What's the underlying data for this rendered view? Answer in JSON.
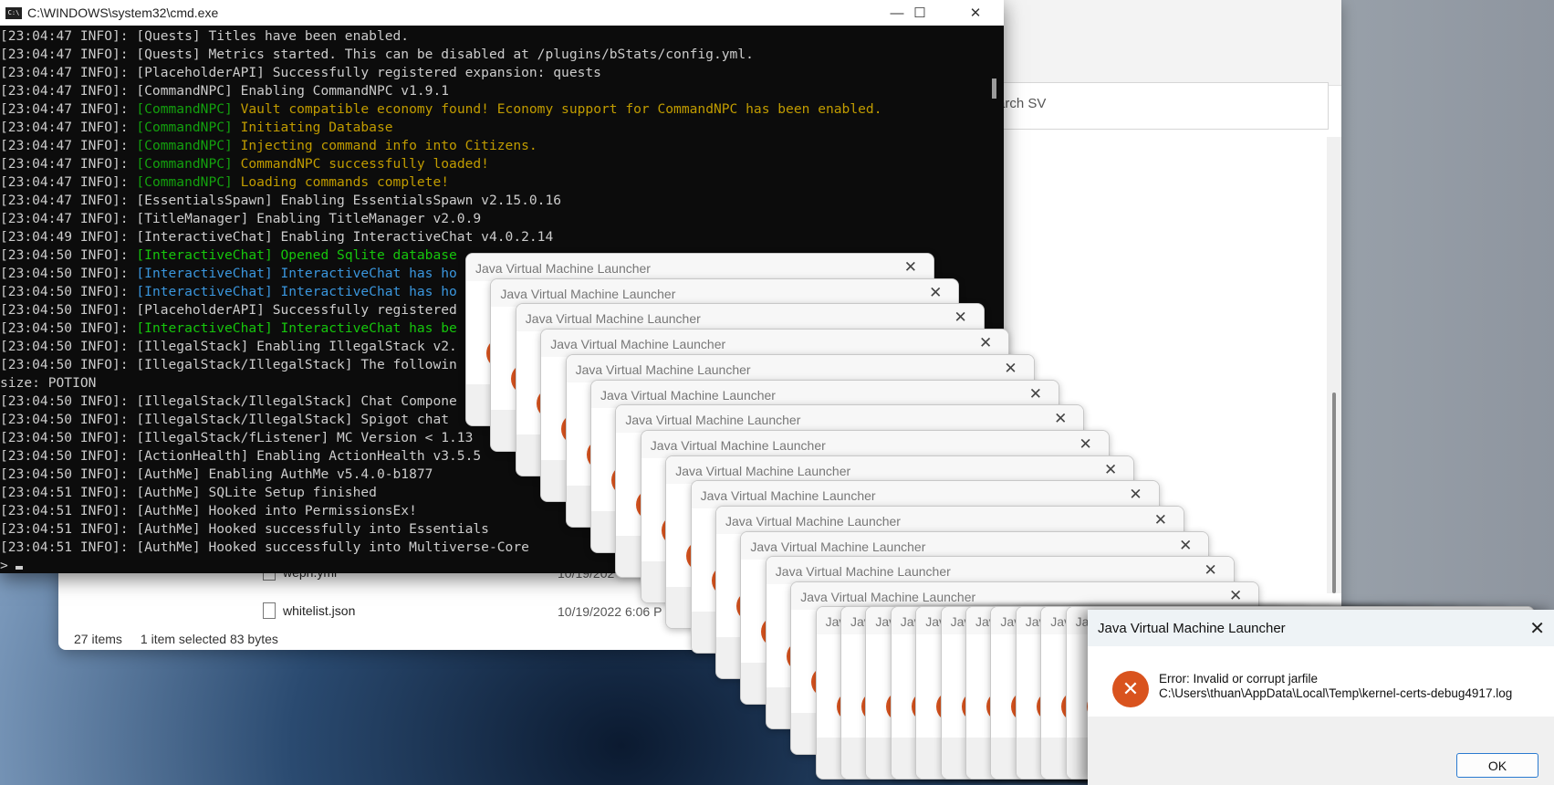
{
  "cmd": {
    "title": "C:\\WINDOWS\\system32\\cmd.exe",
    "icon_label": "C:\\",
    "minimize": "—",
    "maximize": "☐",
    "close": "✕",
    "prompt": ">",
    "lines": [
      [
        [
          "[23:04:47 INFO]: [Quests] Titles have been enabled.",
          "#cccccc"
        ]
      ],
      [
        [
          "[23:04:47 INFO]: [Quests] Metrics started. This can be disabled at /plugins/bStats/config.yml.",
          "#cccccc"
        ]
      ],
      [
        [
          "[23:04:47 INFO]: [PlaceholderAPI] Successfully registered expansion: quests",
          "#cccccc"
        ]
      ],
      [
        [
          "[23:04:47 INFO]: [CommandNPC] Enabling CommandNPC v1.9.1",
          "#cccccc"
        ]
      ],
      [
        [
          "[23:04:47 INFO]: ",
          "#cccccc"
        ],
        [
          "[CommandNPC]",
          "#13a10e"
        ],
        [
          " Vault compatible economy found! Economy support for CommandNPC has been enabled.",
          "#c19c00"
        ]
      ],
      [
        [
          "[23:04:47 INFO]: ",
          "#cccccc"
        ],
        [
          "[CommandNPC]",
          "#13a10e"
        ],
        [
          " Initiating Database",
          "#c19c00"
        ]
      ],
      [
        [
          "[23:04:47 INFO]: ",
          "#cccccc"
        ],
        [
          "[CommandNPC]",
          "#13a10e"
        ],
        [
          " Injecting command info into Citizens.",
          "#c19c00"
        ]
      ],
      [
        [
          "[23:04:47 INFO]: ",
          "#cccccc"
        ],
        [
          "[CommandNPC]",
          "#13a10e"
        ],
        [
          " CommandNPC successfully loaded!",
          "#c19c00"
        ]
      ],
      [
        [
          "[23:04:47 INFO]: ",
          "#cccccc"
        ],
        [
          "[CommandNPC]",
          "#13a10e"
        ],
        [
          " Loading commands complete!",
          "#c19c00"
        ]
      ],
      [
        [
          "[23:04:47 INFO]: [EssentialsSpawn] Enabling EssentialsSpawn v2.15.0.16",
          "#cccccc"
        ]
      ],
      [
        [
          "[23:04:47 INFO]: [TitleManager] Enabling TitleManager v2.0.9",
          "#cccccc"
        ]
      ],
      [
        [
          "[23:04:49 INFO]: [InteractiveChat] Enabling InteractiveChat v4.0.2.14",
          "#cccccc"
        ]
      ],
      [
        [
          "[23:04:50 INFO]: ",
          "#cccccc"
        ],
        [
          "[InteractiveChat] Opened Sqlite database",
          "#16c60c"
        ]
      ],
      [
        [
          "[23:04:50 INFO]: ",
          "#cccccc"
        ],
        [
          "[InteractiveChat] InteractiveChat has ho",
          "#3a96dd"
        ]
      ],
      [
        [
          "[23:04:50 INFO]: ",
          "#cccccc"
        ],
        [
          "[InteractiveChat] InteractiveChat has ho",
          "#3a96dd"
        ]
      ],
      [
        [
          "[23:04:50 INFO]: [PlaceholderAPI] Successfully registered",
          "#cccccc"
        ]
      ],
      [
        [
          "[23:04:50 INFO]: ",
          "#cccccc"
        ],
        [
          "[InteractiveChat] InteractiveChat has be",
          "#16c60c"
        ]
      ],
      [
        [
          "[23:04:50 INFO]: [IllegalStack] Enabling IllegalStack v2.",
          "#cccccc"
        ]
      ],
      [
        [
          "[23:04:50 INFO]: [IllegalStack/IllegalStack] The followin",
          "#cccccc"
        ]
      ],
      [
        [
          "size: POTION",
          "#cccccc"
        ]
      ],
      [
        [
          "[23:04:50 INFO]: [IllegalStack/IllegalStack] Chat Compone",
          "#cccccc"
        ]
      ],
      [
        [
          "[23:04:50 INFO]: [IllegalStack/IllegalStack] Spigot chat",
          "#cccccc"
        ]
      ],
      [
        [
          "[23:04:50 INFO]: [IllegalStack/fListener] MC Version < 1.13",
          "#cccccc"
        ]
      ],
      [
        [
          "[23:04:50 INFO]: [ActionHealth] Enabling ActionHealth v3.5.5",
          "#cccccc"
        ]
      ],
      [
        [
          "[23:04:50 INFO]: [AuthMe] Enabling AuthMe v5.4.0-b1877",
          "#cccccc"
        ]
      ],
      [
        [
          "[23:04:51 INFO]: [AuthMe] SQLite Setup finished",
          "#cccccc"
        ]
      ],
      [
        [
          "[23:04:51 INFO]: [AuthMe] Hooked into PermissionsEx!",
          "#cccccc"
        ]
      ],
      [
        [
          "[23:04:51 INFO]: [AuthMe] Hooked successfully into Essentials",
          "#cccccc"
        ]
      ],
      [
        [
          "[23:04:51 INFO]: [AuthMe] Hooked successfully into Multiverse-Core",
          "#cccccc"
        ]
      ]
    ]
  },
  "explorer": {
    "search_placeholder": "arch SV",
    "files": [
      {
        "name": "wepn.yml",
        "date": "10/19/202"
      },
      {
        "name": "whitelist.json",
        "date": "10/19/2022 6:06 P"
      }
    ],
    "status": {
      "items": "27 items",
      "selected": "1 item selected  83 bytes"
    }
  },
  "jvm": {
    "title": "Java Virtual Machine Launcher",
    "close": "✕",
    "stacked_count": 25,
    "error": {
      "icon": "✕",
      "line1": "Error: Invalid or corrupt jarfile",
      "line2": "C:\\Users\\thuan\\AppData\\Local\\Temp\\kernel-certs-debug4917.log",
      "ok": "OK"
    }
  }
}
